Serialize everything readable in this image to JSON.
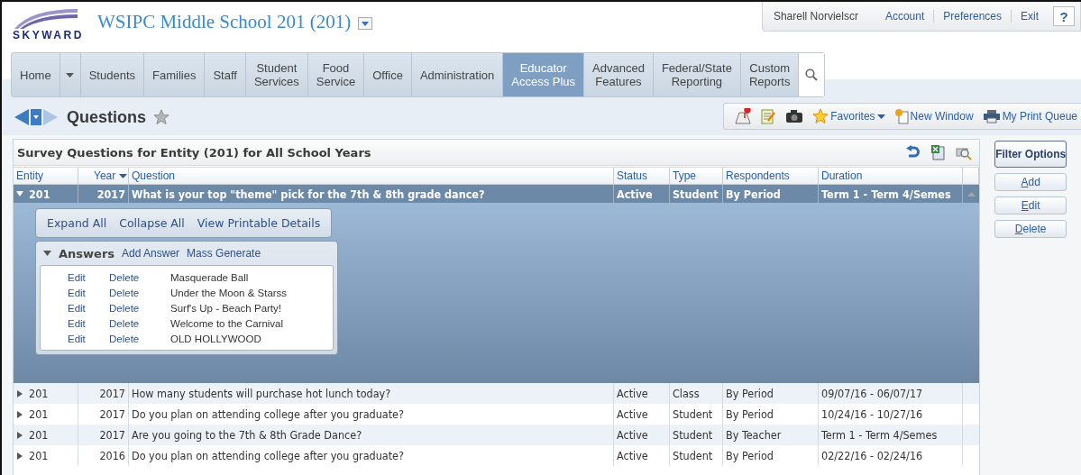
{
  "header": {
    "logo": "SKYWARD",
    "school": "WSIPC Middle School 201 (201)",
    "user": "Sharell Norvielscr",
    "links": [
      "Account",
      "Preferences",
      "Exit"
    ],
    "help": "?"
  },
  "nav": [
    {
      "label": "Home",
      "selected": false,
      "dropdown": true
    },
    {
      "label": "Students",
      "selected": false
    },
    {
      "label": "Families",
      "selected": false
    },
    {
      "label": "Staff",
      "selected": false
    },
    {
      "label": "Student\nServices",
      "selected": false
    },
    {
      "label": "Food\nService",
      "selected": false
    },
    {
      "label": "Office",
      "selected": false
    },
    {
      "label": "Administration",
      "selected": false
    },
    {
      "label": "Educator\nAccess Plus",
      "selected": true
    },
    {
      "label": "Advanced\nFeatures",
      "selected": false
    },
    {
      "label": "Federal/State\nReporting",
      "selected": false
    },
    {
      "label": "Custom\nReports",
      "selected": false
    }
  ],
  "page": {
    "title": "Questions",
    "tools": [
      {
        "kind": "favorites",
        "label": "Favorites"
      },
      {
        "kind": "window",
        "label": "New Window"
      },
      {
        "kind": "print",
        "label": "My Print Queue"
      }
    ]
  },
  "grid": {
    "title": "Survey Questions for Entity (201) for All School Years",
    "columns": [
      {
        "label": "Entity",
        "sorted": false
      },
      {
        "label": "Year",
        "sorted": true
      },
      {
        "label": "Question",
        "sorted": false
      },
      {
        "label": "Status",
        "sorted": false
      },
      {
        "label": "Type",
        "sorted": false
      },
      {
        "label": "Respondents",
        "sorted": false
      },
      {
        "label": "Duration",
        "sorted": false
      }
    ],
    "rows": [
      {
        "entity": "201",
        "year": "2017",
        "question": "What is your top \"theme\" pick for the 7th & 8th grade dance?",
        "status": "Active",
        "type": "Student",
        "respondents": "By Period",
        "duration": "Term 1 - Term 4/Semes",
        "expanded": true,
        "detail": {
          "actions": [
            "Expand All",
            "Collapse All",
            "View Printable Details"
          ],
          "answers_title": "Answers",
          "answer_actions": [
            "Add Answer",
            "Mass Generate"
          ],
          "answers": [
            {
              "edit": "Edit",
              "delete": "Delete",
              "text": "Masquerade Ball"
            },
            {
              "edit": "Edit",
              "delete": "Delete",
              "text": "Under the Moon & Starss"
            },
            {
              "edit": "Edit",
              "delete": "Delete",
              "text": "Surf's Up - Beach Party!"
            },
            {
              "edit": "Edit",
              "delete": "Delete",
              "text": "Welcome to the Carnival"
            },
            {
              "edit": "Edit",
              "delete": "Delete",
              "text": "OLD HOLLYWOOD"
            }
          ]
        }
      },
      {
        "entity": "201",
        "year": "2017",
        "question": "How many students will purchase hot lunch today?",
        "status": "Active",
        "type": "Class",
        "respondents": "By Period",
        "duration": "09/07/16 - 06/07/17",
        "expanded": false
      },
      {
        "entity": "201",
        "year": "2017",
        "question": "Do you plan on attending college after you graduate?",
        "status": "Active",
        "type": "Student",
        "respondents": "By Period",
        "duration": "10/24/16 - 10/27/16",
        "expanded": false
      },
      {
        "entity": "201",
        "year": "2017",
        "question": "Are you going to the 7th & 8th Grade Dance?",
        "status": "Active",
        "type": "Student",
        "respondents": "By Teacher",
        "duration": "Term 1 - Term 4/Semes",
        "expanded": false
      },
      {
        "entity": "201",
        "year": "2016",
        "question": "Do you plan on attending college after you graduate?",
        "status": "Active",
        "type": "Student",
        "respondents": "By Period",
        "duration": "02/22/16 - 02/24/16",
        "expanded": false
      }
    ]
  },
  "side_buttons": [
    "Filter Options",
    "Add",
    "Edit",
    "Delete"
  ]
}
